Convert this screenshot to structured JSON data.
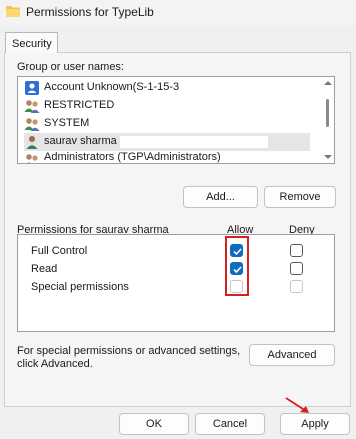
{
  "window": {
    "title": "Permissions for TypeLib"
  },
  "tabs": [
    {
      "label": "Security"
    }
  ],
  "group_section": {
    "label": "Group or user names:",
    "users": [
      {
        "name": "Account Unknown(S-1-15-3",
        "icon": "unknown-account-icon"
      },
      {
        "name": "RESTRICTED",
        "icon": "group-icon"
      },
      {
        "name": "SYSTEM",
        "icon": "group-icon"
      },
      {
        "name": "saurav sharma",
        "icon": "user-icon",
        "selected": true
      },
      {
        "name": "Administrators (TGP\\Administrators)",
        "icon": "group-icon"
      }
    ],
    "add_label": "Add...",
    "remove_label": "Remove"
  },
  "permissions": {
    "label": "Permissions for saurav sharma",
    "allow_header": "Allow",
    "deny_header": "Deny",
    "rows": [
      {
        "name": "Full Control",
        "allow": true,
        "deny": false
      },
      {
        "name": "Read",
        "allow": true,
        "deny": false
      },
      {
        "name": "Special permissions",
        "allow": false,
        "deny": false
      }
    ]
  },
  "advanced": {
    "text": "For special permissions or advanced settings, click Advanced.",
    "button_label": "Advanced"
  },
  "footer": {
    "ok": "OK",
    "cancel": "Cancel",
    "apply": "Apply"
  },
  "colors": {
    "accent": "#0f6cbd",
    "annotation": "#d42020"
  }
}
